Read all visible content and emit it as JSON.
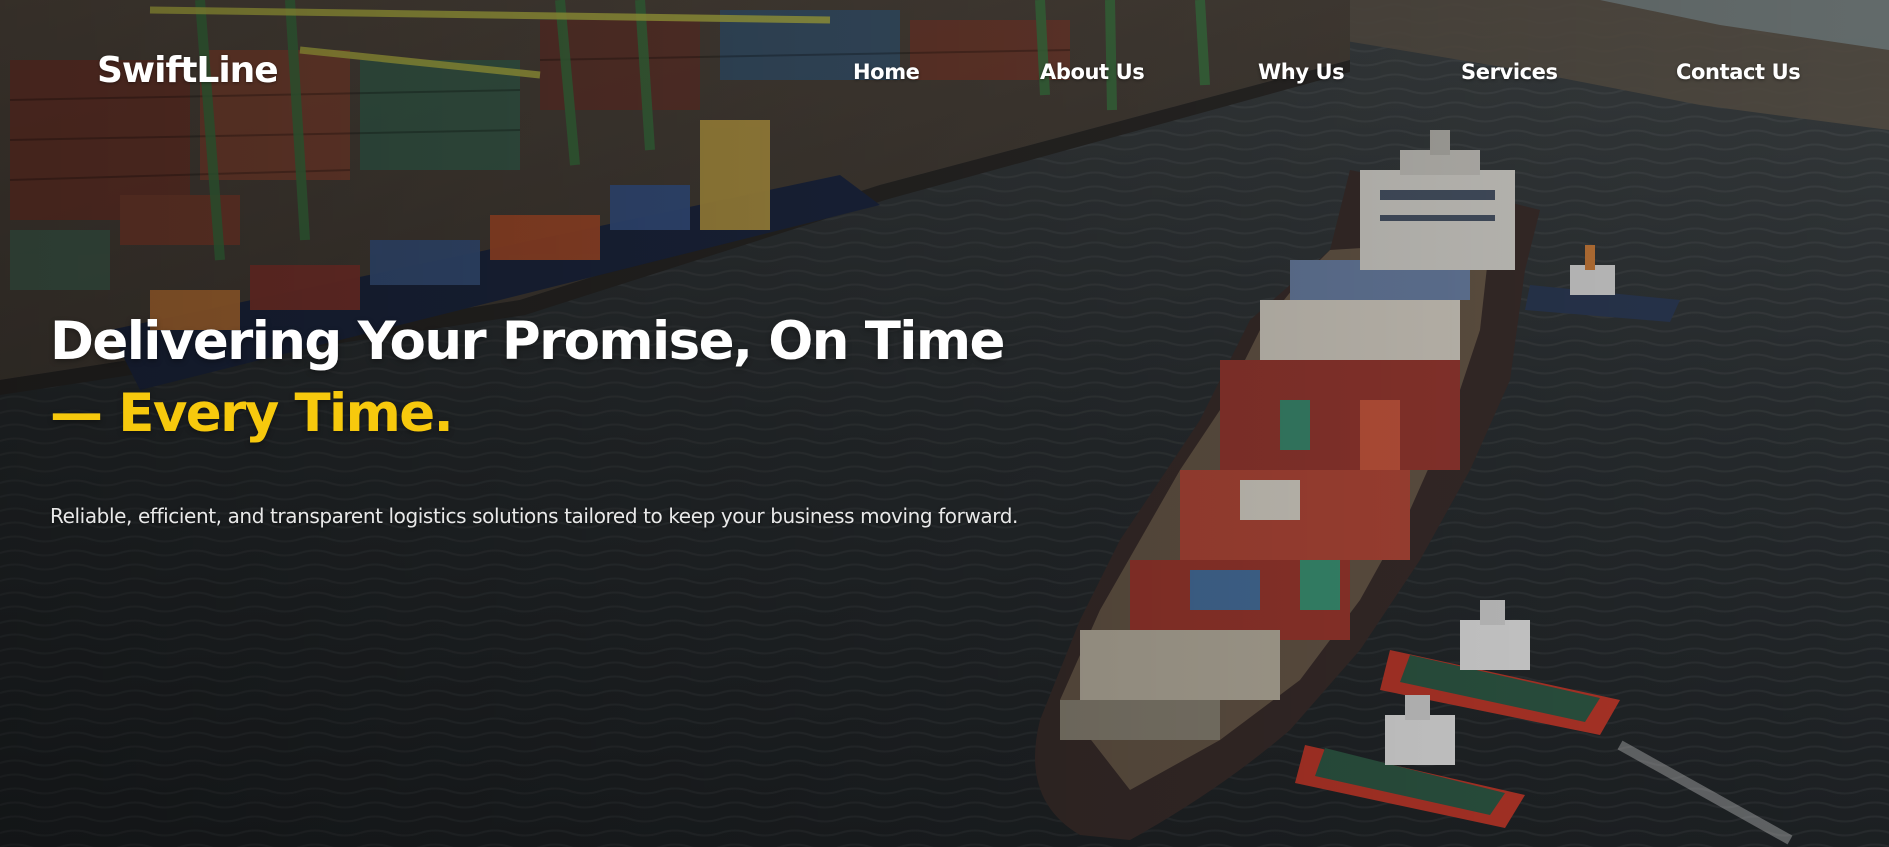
{
  "brand": {
    "logo": "SwiftLine",
    "accent_color": "#f7c90d",
    "text_color": "#ffffff"
  },
  "nav": {
    "home": "Home",
    "about": "About Us",
    "why": "Why Us",
    "services": "Services",
    "contact": "Contact Us"
  },
  "hero": {
    "headline_line1": "Delivering Your Promise, On Time",
    "headline_line2": "— Every Time.",
    "subtitle": "Reliable, efficient, and transparent logistics solutions tailored to keep your business moving forward.",
    "background_image": "port-container-ship-aerial-photo"
  }
}
